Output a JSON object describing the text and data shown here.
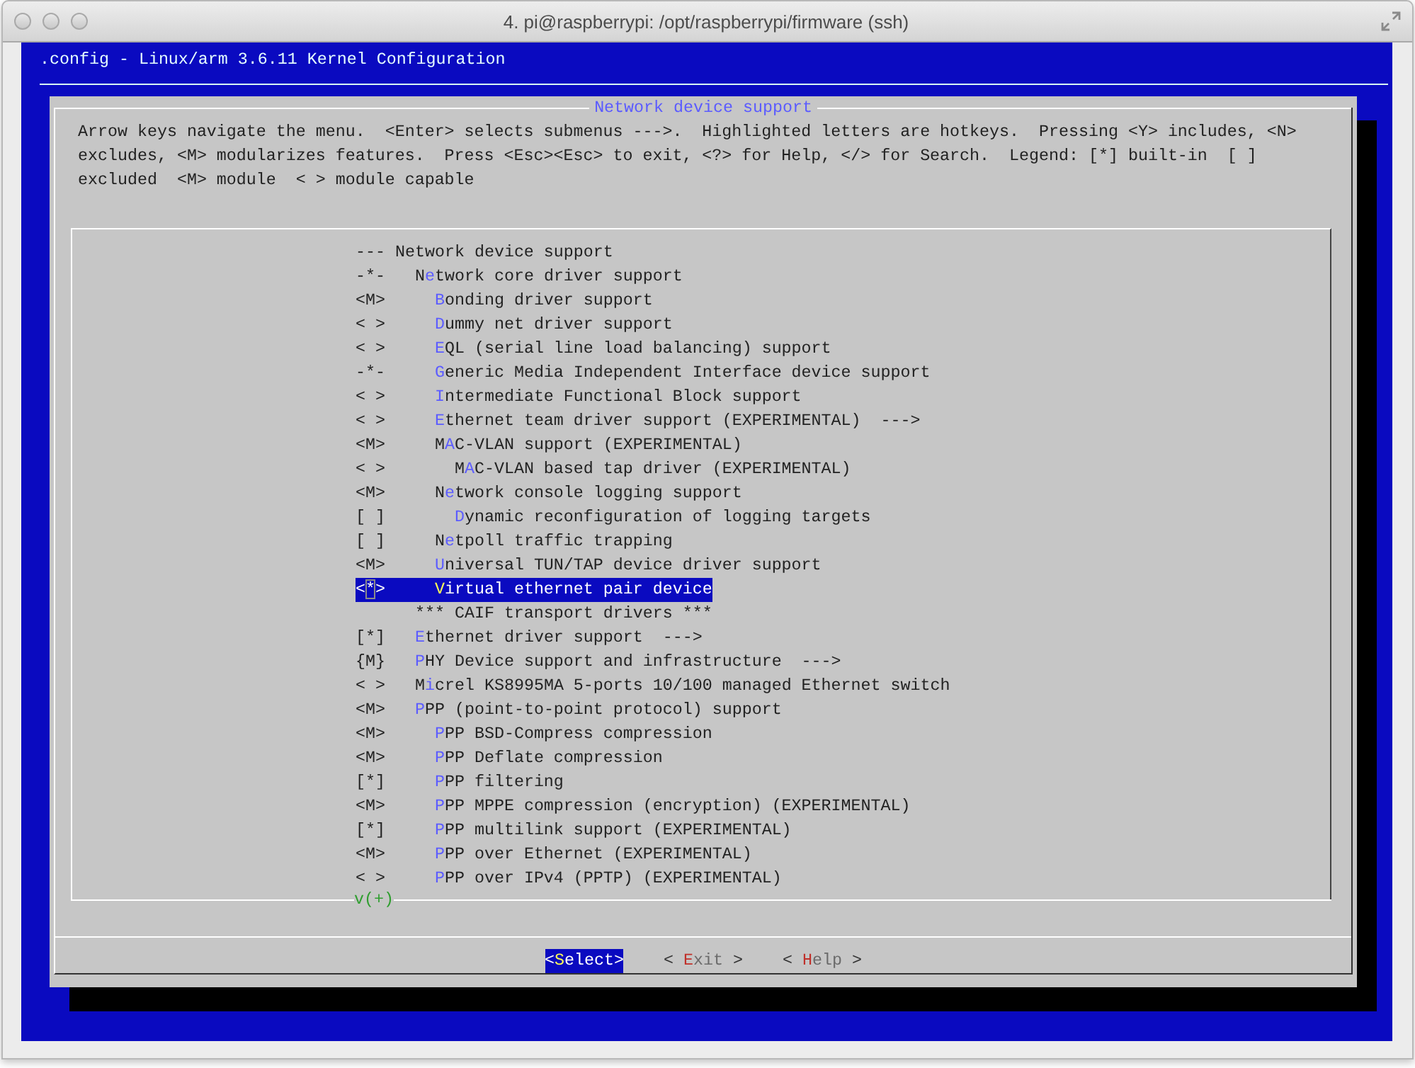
{
  "window": {
    "title": "4. pi@raspberrypi: /opt/raspberrypi/firmware (ssh)"
  },
  "screen_title": ".config - Linux/arm 3.6.11 Kernel Configuration",
  "dialog": {
    "title": "Network device support",
    "help_lines": [
      "Arrow keys navigate the menu.  <Enter> selects submenus --->.  Highlighted letters are hotkeys.  Pressing <Y> includes, <N>",
      "excludes, <M> modularizes features.  Press <Esc><Esc> to exit, <?> for Help, </> for Search.  Legend: [*] built-in  [ ]",
      "excluded  <M> module  < > module capable"
    ],
    "menu": [
      {
        "kind": "header",
        "state": "---",
        "label": "Network device support",
        "selected": false,
        "children": [
          {
            "kind": "option",
            "state": "-*-",
            "lead": "N",
            "hotkey": "e",
            "label": "twork core driver support",
            "selected": false,
            "children": [
              {
                "kind": "option",
                "state": "<M>",
                "hotkey": "B",
                "label": "onding driver support",
                "selected": false
              },
              {
                "kind": "option",
                "state": "< >",
                "hotkey": "D",
                "label": "ummy net driver support",
                "selected": false
              },
              {
                "kind": "option",
                "state": "< >",
                "hotkey": "E",
                "label": "QL (serial line load balancing) support",
                "selected": false
              },
              {
                "kind": "option",
                "state": "-*-",
                "hotkey": "G",
                "label": "eneric Media Independent Interface device support",
                "selected": false
              },
              {
                "kind": "option",
                "state": "< >",
                "hotkey": "I",
                "label": "ntermediate Functional Block support",
                "selected": false
              },
              {
                "kind": "option",
                "state": "< >",
                "hotkey": "E",
                "label": "thernet team driver support (EXPERIMENTAL)  --->",
                "selected": false
              },
              {
                "kind": "option",
                "state": "<M>",
                "lead": "M",
                "hotkey": "A",
                "label": "C-VLAN support (EXPERIMENTAL)",
                "selected": false,
                "children": [
                  {
                    "kind": "option",
                    "state": "< >",
                    "lead": "M",
                    "hotkey": "A",
                    "label": "C-VLAN based tap driver (EXPERIMENTAL)",
                    "selected": false
                  }
                ]
              },
              {
                "kind": "option",
                "state": "<M>",
                "lead": "N",
                "hotkey": "e",
                "label": "twork console logging support",
                "selected": false,
                "children": [
                  {
                    "kind": "option",
                    "state": "[ ]",
                    "hotkey": "D",
                    "label": "ynamic reconfiguration of logging targets",
                    "selected": false
                  }
                ]
              },
              {
                "kind": "option",
                "state": "[ ]",
                "lead": "N",
                "hotkey": "e",
                "label": "tpoll traffic trapping",
                "selected": false
              },
              {
                "kind": "option",
                "state": "<M>",
                "hotkey": "U",
                "label": "niversal TUN/TAP device driver support",
                "selected": false
              },
              {
                "kind": "option",
                "state": "<*>",
                "hotkey": "V",
                "label": "irtual ethernet pair device",
                "selected": true
              }
            ]
          },
          {
            "kind": "comment",
            "label": "*** CAIF transport drivers ***"
          },
          {
            "kind": "option",
            "state": "[*]",
            "hotkey": "E",
            "label": "thernet driver support  --->",
            "selected": false
          },
          {
            "kind": "option",
            "state": "{M}",
            "hotkey": "P",
            "label": "HY Device support and infrastructure  --->",
            "selected": false
          },
          {
            "kind": "option",
            "state": "< >",
            "lead": "M",
            "hotkey": "i",
            "label": "crel KS8995MA 5-ports 10/100 managed Ethernet switch",
            "selected": false
          },
          {
            "kind": "option",
            "state": "<M>",
            "hotkey": "P",
            "label": "PP (point-to-point protocol) support",
            "selected": false,
            "children": [
              {
                "kind": "option",
                "state": "<M>",
                "hotkey": "P",
                "label": "PP BSD-Compress compression",
                "selected": false
              },
              {
                "kind": "option",
                "state": "<M>",
                "hotkey": "P",
                "label": "PP Deflate compression",
                "selected": false
              },
              {
                "kind": "option",
                "state": "[*]",
                "hotkey": "P",
                "label": "PP filtering",
                "selected": false
              },
              {
                "kind": "option",
                "state": "<M>",
                "hotkey": "P",
                "label": "PP MPPE compression (encryption) (EXPERIMENTAL)",
                "selected": false
              },
              {
                "kind": "option",
                "state": "[*]",
                "hotkey": "P",
                "label": "PP multilink support (EXPERIMENTAL)",
                "selected": false
              },
              {
                "kind": "option",
                "state": "<M>",
                "hotkey": "P",
                "label": "PP over Ethernet (EXPERIMENTAL)",
                "selected": false
              },
              {
                "kind": "option",
                "state": "< >",
                "hotkey": "P",
                "label": "PP over IPv4 (PPTP) (EXPERIMENTAL)",
                "selected": false
              }
            ]
          }
        ]
      }
    ],
    "more_indicator": "v(+)",
    "buttons": [
      {
        "open": "<",
        "hotkey": "S",
        "rest": "elect",
        "close": ">",
        "selected": true
      },
      {
        "open": "< ",
        "hotkey": "E",
        "rest": "xit",
        "close": " >",
        "selected": false
      },
      {
        "open": "< ",
        "hotkey": "H",
        "rest": "elp",
        "close": " >",
        "selected": false
      }
    ]
  }
}
